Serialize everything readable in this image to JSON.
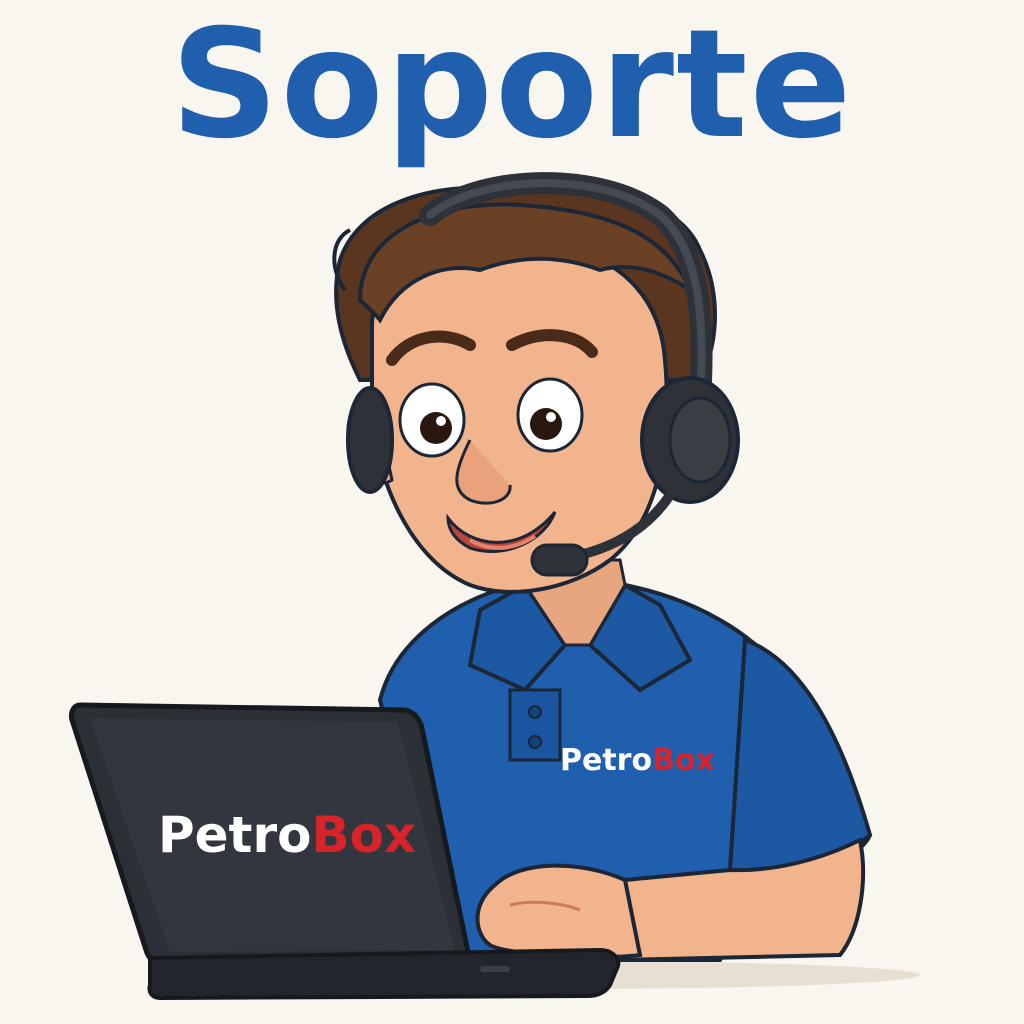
{
  "title": "Soporte",
  "brand": {
    "part1": "Petro",
    "part2": "Box",
    "color_part1": "#ffffff",
    "color_part2": "#d8232a"
  },
  "colors": {
    "background": "#f9f6ef",
    "title": "#1f5fae",
    "shirt": "#1f5fae",
    "laptop": "#2b2f36",
    "hair": "#5a3620",
    "skin": "#f2b48c",
    "headset": "#2e3238"
  },
  "icons": {
    "headset": "headset-icon",
    "laptop": "laptop-icon"
  }
}
